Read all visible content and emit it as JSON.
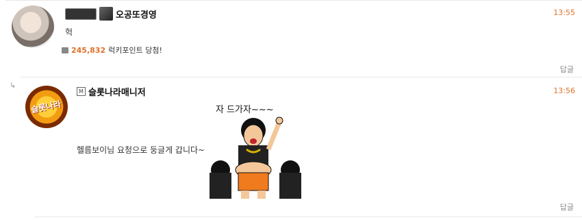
{
  "comments": [
    {
      "badge_text": "",
      "nickname": "오공또경영",
      "time": "13:55",
      "text": "헉",
      "lucky_points": "245,832",
      "lucky_label": "럭키포인트 당첨!",
      "reply_label": "답글"
    },
    {
      "nickname": "슬롯나라매니저",
      "time": "13:56",
      "sticker_caption": "자 드가자~~~",
      "text": "헬름보이님 요청으로 둥글게 갑니다~",
      "reply_label": "답글",
      "avatar_text": "슬롯나라"
    }
  ],
  "colors": {
    "accent": "#e0702a",
    "divider": "#e8e8e8"
  }
}
